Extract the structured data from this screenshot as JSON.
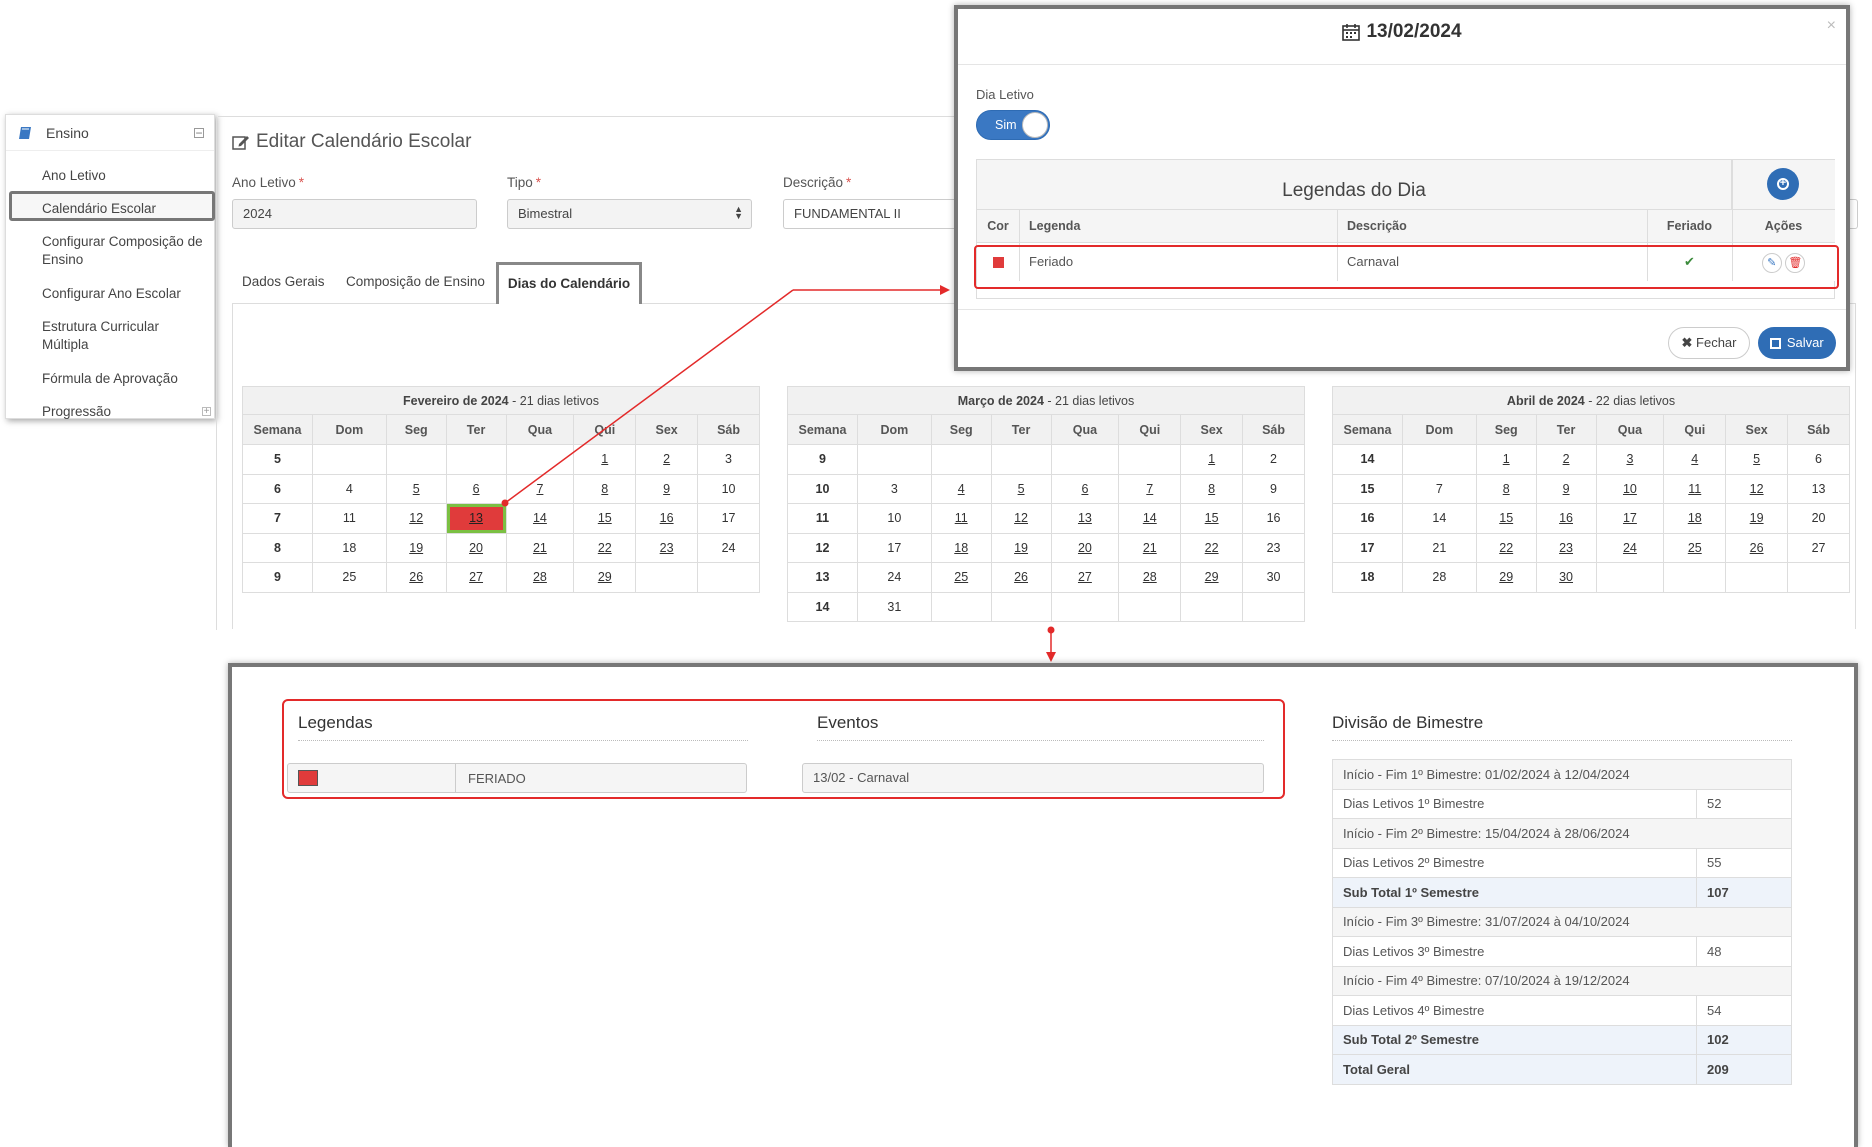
{
  "sidebar": {
    "header": "Ensino",
    "items": [
      {
        "label": "Ano Letivo"
      },
      {
        "label": "Calendário Escolar"
      },
      {
        "label": "Configurar Composição de Ensino"
      },
      {
        "label": "Configurar Ano Escolar"
      },
      {
        "label": "Estrutura Curricular Múltipla"
      },
      {
        "label": "Fórmula de Aprovação"
      },
      {
        "label": "Progressão"
      }
    ]
  },
  "page": {
    "title": "Editar Calendário Escolar",
    "fields": {
      "ano_letivo": {
        "label": "Ano Letivo",
        "value": "2024"
      },
      "tipo": {
        "label": "Tipo",
        "value": "Bimestral"
      },
      "descricao": {
        "label": "Descrição",
        "value": "FUNDAMENTAL II"
      }
    },
    "required_mark": "*",
    "tabs": [
      "Dados Gerais",
      "Composição de Ensino",
      "Dias do Calendário"
    ]
  },
  "calendars": {
    "day_headers": [
      "Semana",
      "Dom",
      "Seg",
      "Ter",
      "Qua",
      "Qui",
      "Sex",
      "Sáb"
    ],
    "months": [
      {
        "title": "Fevereiro de 2024",
        "subtitle": " - 21 dias letivos",
        "weeks": [
          [
            "5",
            "",
            "",
            "",
            "",
            "1",
            "2",
            "3"
          ],
          [
            "6",
            "4",
            "5",
            "6",
            "7",
            "8",
            "9",
            "10"
          ],
          [
            "7",
            "11",
            "12",
            "13",
            "14",
            "15",
            "16",
            "17"
          ],
          [
            "8",
            "18",
            "19",
            "20",
            "21",
            "22",
            "23",
            "24"
          ],
          [
            "9",
            "25",
            "26",
            "27",
            "28",
            "29",
            "",
            ""
          ]
        ]
      },
      {
        "title": "Março de 2024",
        "subtitle": " - 21 dias letivos",
        "weeks": [
          [
            "9",
            "",
            "",
            "",
            "",
            "",
            "1",
            "2"
          ],
          [
            "10",
            "3",
            "4",
            "5",
            "6",
            "7",
            "8",
            "9"
          ],
          [
            "11",
            "10",
            "11",
            "12",
            "13",
            "14",
            "15",
            "16"
          ],
          [
            "12",
            "17",
            "18",
            "19",
            "20",
            "21",
            "22",
            "23"
          ],
          [
            "13",
            "24",
            "25",
            "26",
            "27",
            "28",
            "29",
            "30"
          ],
          [
            "14",
            "31",
            "",
            "",
            "",
            "",
            "",
            ""
          ]
        ]
      },
      {
        "title": "Abril de 2024",
        "subtitle": " - 22 dias letivos",
        "weeks": [
          [
            "14",
            "",
            "1",
            "2",
            "3",
            "4",
            "5",
            "6"
          ],
          [
            "15",
            "7",
            "8",
            "9",
            "10",
            "11",
            "12",
            "13"
          ],
          [
            "16",
            "14",
            "15",
            "16",
            "17",
            "18",
            "19",
            "20"
          ],
          [
            "17",
            "21",
            "22",
            "23",
            "24",
            "25",
            "26",
            "27"
          ],
          [
            "18",
            "28",
            "29",
            "30",
            "",
            "",
            "",
            ""
          ]
        ]
      }
    ],
    "highlighted_day": {
      "month_index": 0,
      "day": "13",
      "color": "#e03b3b"
    }
  },
  "modal": {
    "title": "13/02/2024",
    "close": "×",
    "dia_letivo_label": "Dia Letivo",
    "toggle_label": "Sim",
    "legendas_title": "Legendas do Dia",
    "columns": [
      "Cor",
      "Legenda",
      "Descrição",
      "Feriado",
      "Ações"
    ],
    "row": {
      "cor": "#e03b3b",
      "legenda": "Feriado",
      "descricao": "Carnaval",
      "feriado_check": "✔"
    },
    "btn_fechar": "Fechar",
    "btn_salvar": "Salvar"
  },
  "bottom": {
    "legendas_title": "Legendas",
    "legenda_item": {
      "color": "#e03b3b",
      "label": "FERIADO"
    },
    "eventos_title": "Eventos",
    "evento_item": "13/02 - Carnaval",
    "divisao_title": "Divisão de Bimestre",
    "divisao_rows": [
      {
        "label": "Início - Fim 1º Bimestre: 01/02/2024 à 12/04/2024",
        "value": "",
        "kind": "full"
      },
      {
        "label": "Dias Letivos 1º Bimestre",
        "value": "52",
        "kind": "pair"
      },
      {
        "label": "Início - Fim 2º Bimestre: 15/04/2024 à 28/06/2024",
        "value": "",
        "kind": "full"
      },
      {
        "label": "Dias Letivos 2º Bimestre",
        "value": "55",
        "kind": "pair"
      },
      {
        "label": "Sub Total 1º Semestre",
        "value": "107",
        "kind": "sub"
      },
      {
        "label": "Início - Fim 3º Bimestre: 31/07/2024 à 04/10/2024",
        "value": "",
        "kind": "full"
      },
      {
        "label": "Dias Letivos 3º Bimestre",
        "value": "48",
        "kind": "pair"
      },
      {
        "label": "Início - Fim 4º Bimestre: 07/10/2024 à 19/12/2024",
        "value": "",
        "kind": "full"
      },
      {
        "label": "Dias Letivos 4º Bimestre",
        "value": "54",
        "kind": "pair"
      },
      {
        "label": "Sub Total 2º Semestre",
        "value": "102",
        "kind": "sub"
      },
      {
        "label": "Total Geral",
        "value": "209",
        "kind": "sub"
      }
    ]
  }
}
